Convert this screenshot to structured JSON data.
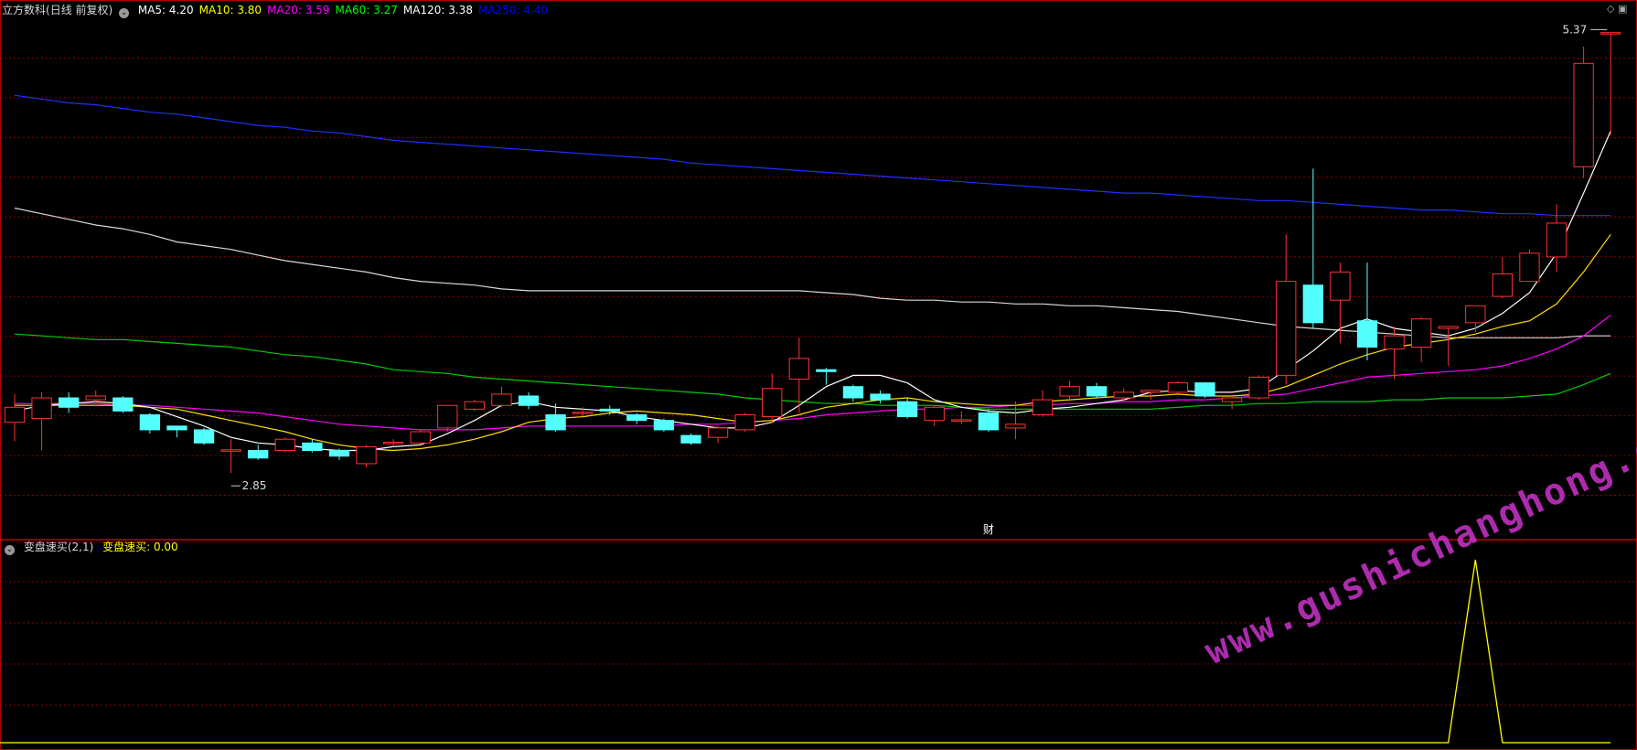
{
  "main_legend": {
    "title": "立方数科",
    "mode": "(日线 前复权)",
    "ma_items": [
      {
        "label": "MA5: 4.20",
        "color": "#ffffff"
      },
      {
        "label": "MA10: 3.80",
        "color": "#ffff00"
      },
      {
        "label": "MA20: 3.59",
        "color": "#ff00ff"
      },
      {
        "label": "MA60: 3.27",
        "color": "#00ff00"
      },
      {
        "label": "MA120: 3.38",
        "color": "#ffffff"
      },
      {
        "label": "MA250: 4.40",
        "color": "#0000ff"
      }
    ]
  },
  "sub_legend": {
    "title": "变盘速买(2,1)",
    "value_label": "变盘速买: 0.00"
  },
  "annotations": {
    "high": "5.37",
    "low": "2.85",
    "marker": "财"
  },
  "watermark": "www.gushichanghong.com",
  "colors": {
    "up": "#ff3232",
    "down": "#54ffff",
    "grid": "#8b0000",
    "indicator": "#ffff00"
  },
  "chart_data": [
    {
      "type": "candlestick",
      "title": "立方数科 (日线 前复权)",
      "ylim": [
        2.7,
        5.45
      ],
      "candles": [
        [
          3.3,
          3.38,
          3.2,
          3.45
        ],
        [
          3.32,
          3.43,
          3.15,
          3.46
        ],
        [
          3.43,
          3.38,
          3.35,
          3.46
        ],
        [
          3.42,
          3.44,
          3.4,
          3.47
        ],
        [
          3.43,
          3.36,
          3.35,
          3.44
        ],
        [
          3.34,
          3.26,
          3.24,
          3.35
        ],
        [
          3.28,
          3.26,
          3.22,
          3.28
        ],
        [
          3.26,
          3.19,
          3.18,
          3.27
        ],
        [
          3.15,
          3.15,
          3.03,
          3.21
        ],
        [
          3.15,
          3.11,
          3.1,
          3.18
        ],
        [
          3.15,
          3.21,
          3.14,
          3.22
        ],
        [
          3.19,
          3.15,
          3.14,
          3.21
        ],
        [
          3.15,
          3.12,
          3.1,
          3.16
        ],
        [
          3.08,
          3.17,
          3.06,
          3.18
        ],
        [
          3.19,
          3.19,
          3.17,
          3.21
        ],
        [
          3.19,
          3.25,
          3.18,
          3.26
        ],
        [
          3.27,
          3.39,
          3.25,
          3.39
        ],
        [
          3.37,
          3.41,
          3.36,
          3.42
        ],
        [
          3.39,
          3.45,
          3.38,
          3.49
        ],
        [
          3.44,
          3.39,
          3.37,
          3.46
        ],
        [
          3.34,
          3.26,
          3.25,
          3.4
        ],
        [
          3.35,
          3.35,
          3.33,
          3.38
        ],
        [
          3.37,
          3.36,
          3.34,
          3.39
        ],
        [
          3.34,
          3.31,
          3.29,
          3.35
        ],
        [
          3.31,
          3.26,
          3.25,
          3.32
        ],
        [
          3.23,
          3.19,
          3.18,
          3.24
        ],
        [
          3.22,
          3.27,
          3.19,
          3.28
        ],
        [
          3.26,
          3.34,
          3.25,
          3.35
        ],
        [
          3.33,
          3.48,
          3.3,
          3.56
        ],
        [
          3.53,
          3.64,
          3.35,
          3.75
        ],
        [
          3.58,
          3.57,
          3.5,
          3.59
        ],
        [
          3.49,
          3.43,
          3.41,
          3.5
        ],
        [
          3.45,
          3.42,
          3.4,
          3.47
        ],
        [
          3.41,
          3.33,
          3.32,
          3.43
        ],
        [
          3.31,
          3.38,
          3.28,
          3.39
        ],
        [
          3.31,
          3.31,
          3.29,
          3.36
        ],
        [
          3.35,
          3.26,
          3.25,
          3.37
        ],
        [
          3.27,
          3.29,
          3.21,
          3.41
        ],
        [
          3.34,
          3.42,
          3.33,
          3.47
        ],
        [
          3.44,
          3.49,
          3.42,
          3.52
        ],
        [
          3.49,
          3.44,
          3.43,
          3.51
        ],
        [
          3.43,
          3.46,
          3.41,
          3.48
        ],
        [
          3.46,
          3.47,
          3.42,
          3.47
        ],
        [
          3.46,
          3.51,
          3.45,
          3.52
        ],
        [
          3.51,
          3.44,
          3.43,
          3.51
        ],
        [
          3.41,
          3.43,
          3.37,
          3.44
        ],
        [
          3.43,
          3.54,
          3.42,
          3.55
        ],
        [
          3.55,
          4.05,
          3.5,
          4.3
        ],
        [
          4.03,
          3.83,
          3.8,
          4.65
        ],
        [
          3.95,
          4.1,
          3.72,
          4.15
        ],
        [
          3.84,
          3.7,
          3.63,
          4.15
        ],
        [
          3.69,
          3.76,
          3.53,
          3.81
        ],
        [
          3.7,
          3.85,
          3.62,
          3.86
        ],
        [
          3.8,
          3.81,
          3.6,
          3.81
        ],
        [
          3.83,
          3.92,
          3.78,
          3.92
        ],
        [
          3.97,
          4.09,
          3.96,
          4.18
        ],
        [
          4.05,
          4.2,
          4.05,
          4.22
        ],
        [
          4.18,
          4.36,
          4.1,
          4.46
        ],
        [
          4.66,
          5.21,
          4.6,
          5.3
        ],
        [
          5.37,
          5.37,
          4.83,
          5.37
        ]
      ],
      "ma5": [
        3.36,
        3.39,
        3.4,
        3.41,
        3.4,
        3.38,
        3.33,
        3.28,
        3.22,
        3.19,
        3.18,
        3.16,
        3.15,
        3.15,
        3.17,
        3.18,
        3.24,
        3.31,
        3.39,
        3.41,
        3.38,
        3.37,
        3.36,
        3.33,
        3.31,
        3.29,
        3.27,
        3.27,
        3.3,
        3.39,
        3.49,
        3.55,
        3.55,
        3.51,
        3.42,
        3.38,
        3.36,
        3.35,
        3.37,
        3.38,
        3.4,
        3.42,
        3.46,
        3.47,
        3.46,
        3.46,
        3.48,
        3.58,
        3.68,
        3.8,
        3.85,
        3.8,
        3.78,
        3.76,
        3.8,
        3.88,
        3.99,
        4.2,
        4.52,
        4.85
      ],
      "ma10": [
        3.39,
        3.39,
        3.39,
        3.39,
        3.39,
        3.38,
        3.37,
        3.34,
        3.31,
        3.28,
        3.25,
        3.21,
        3.18,
        3.16,
        3.15,
        3.16,
        3.18,
        3.21,
        3.25,
        3.3,
        3.32,
        3.33,
        3.35,
        3.36,
        3.35,
        3.34,
        3.32,
        3.3,
        3.31,
        3.34,
        3.38,
        3.4,
        3.42,
        3.43,
        3.41,
        3.4,
        3.39,
        3.39,
        3.41,
        3.42,
        3.43,
        3.44,
        3.44,
        3.45,
        3.44,
        3.44,
        3.45,
        3.49,
        3.55,
        3.61,
        3.66,
        3.7,
        3.72,
        3.74,
        3.77,
        3.81,
        3.84,
        3.93,
        4.1,
        4.3
      ],
      "ma20": [
        3.4,
        3.4,
        3.4,
        3.4,
        3.39,
        3.39,
        3.38,
        3.37,
        3.36,
        3.35,
        3.33,
        3.31,
        3.29,
        3.28,
        3.27,
        3.26,
        3.26,
        3.26,
        3.27,
        3.28,
        3.28,
        3.28,
        3.28,
        3.28,
        3.28,
        3.29,
        3.29,
        3.3,
        3.31,
        3.32,
        3.34,
        3.35,
        3.36,
        3.37,
        3.37,
        3.38,
        3.38,
        3.39,
        3.39,
        3.4,
        3.4,
        3.41,
        3.41,
        3.42,
        3.42,
        3.43,
        3.44,
        3.45,
        3.48,
        3.51,
        3.54,
        3.55,
        3.56,
        3.57,
        3.58,
        3.6,
        3.64,
        3.69,
        3.76,
        3.87
      ],
      "ma60": [
        3.77,
        3.76,
        3.75,
        3.74,
        3.74,
        3.73,
        3.72,
        3.71,
        3.7,
        3.68,
        3.66,
        3.65,
        3.63,
        3.61,
        3.58,
        3.57,
        3.56,
        3.54,
        3.53,
        3.52,
        3.51,
        3.5,
        3.49,
        3.48,
        3.47,
        3.46,
        3.45,
        3.43,
        3.42,
        3.41,
        3.4,
        3.4,
        3.39,
        3.39,
        3.39,
        3.38,
        3.37,
        3.37,
        3.37,
        3.37,
        3.37,
        3.37,
        3.37,
        3.38,
        3.39,
        3.39,
        3.4,
        3.4,
        3.41,
        3.41,
        3.41,
        3.42,
        3.42,
        3.43,
        3.43,
        3.43,
        3.44,
        3.45,
        3.5,
        3.56
      ],
      "ma120": [
        4.44,
        4.41,
        4.38,
        4.35,
        4.33,
        4.3,
        4.26,
        4.24,
        4.22,
        4.19,
        4.16,
        4.14,
        4.12,
        4.1,
        4.07,
        4.05,
        4.04,
        4.03,
        4.01,
        4.0,
        4.0,
        4.0,
        4.0,
        4.0,
        4.0,
        4.0,
        4.0,
        4.0,
        4.0,
        4.0,
        3.99,
        3.98,
        3.96,
        3.95,
        3.95,
        3.94,
        3.94,
        3.93,
        3.93,
        3.92,
        3.92,
        3.91,
        3.9,
        3.89,
        3.87,
        3.85,
        3.83,
        3.81,
        3.8,
        3.79,
        3.78,
        3.77,
        3.76,
        3.75,
        3.75,
        3.75,
        3.75,
        3.75,
        3.76,
        3.76
      ],
      "ma250": [
        5.04,
        5.02,
        5.0,
        4.99,
        4.97,
        4.95,
        4.94,
        4.92,
        4.9,
        4.88,
        4.87,
        4.85,
        4.84,
        4.82,
        4.8,
        4.79,
        4.78,
        4.77,
        4.76,
        4.75,
        4.74,
        4.73,
        4.72,
        4.71,
        4.7,
        4.68,
        4.67,
        4.66,
        4.65,
        4.64,
        4.63,
        4.62,
        4.61,
        4.6,
        4.59,
        4.58,
        4.57,
        4.56,
        4.55,
        4.54,
        4.53,
        4.52,
        4.52,
        4.51,
        4.5,
        4.49,
        4.48,
        4.48,
        4.47,
        4.46,
        4.45,
        4.44,
        4.43,
        4.43,
        4.42,
        4.41,
        4.41,
        4.4,
        4.4,
        4.4
      ]
    },
    {
      "type": "line",
      "title": "变盘速买(2,1)",
      "ylim": [
        0,
        1
      ],
      "values": [
        0,
        0,
        0,
        0,
        0,
        0,
        0,
        0,
        0,
        0,
        0,
        0,
        0,
        0,
        0,
        0,
        0,
        0,
        0,
        0,
        0,
        0,
        0,
        0,
        0,
        0,
        0,
        0,
        0,
        0,
        0,
        0,
        0,
        0,
        0,
        0,
        0,
        0,
        0,
        0,
        0,
        0,
        0,
        0,
        0,
        0,
        0,
        0,
        0,
        0,
        0,
        0,
        0,
        0,
        1,
        0,
        0,
        0,
        0,
        0
      ]
    }
  ]
}
